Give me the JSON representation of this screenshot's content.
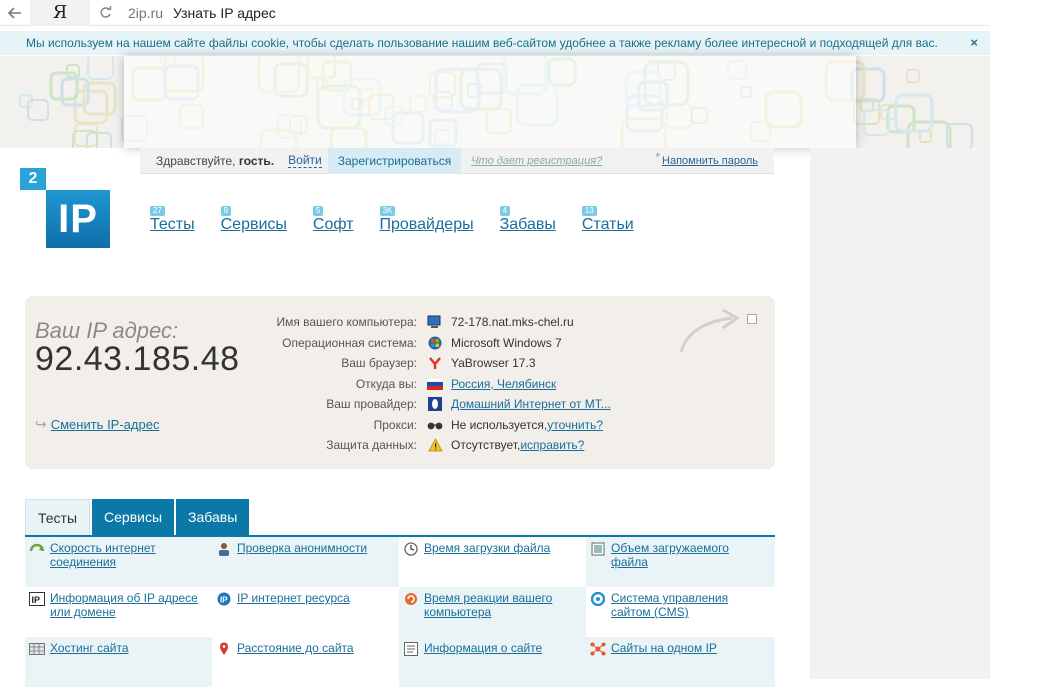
{
  "browser": {
    "back_icon": "arrow-left-icon",
    "yandex_glyph": "Я",
    "reload_icon": "reload-icon",
    "domain": "2ip.ru",
    "title": "Узнать IP адрес"
  },
  "cookie": {
    "text": "Мы используем на нашем сайте файлы cookie, чтобы сделать пользование нашим веб-сайтом удобнее а также рекламу более интересной и подходящей для вас.",
    "close": "×"
  },
  "login": {
    "hello": "Здравствуйте, ",
    "guest": "гость.",
    "login_link": "Войти",
    "register": "Зарегистрироваться",
    "what_gives": "Что дает регистрация?",
    "star": "*",
    "remind": "Напомнить пароль"
  },
  "logo": {
    "small": "2",
    "big": "IP"
  },
  "nav": [
    {
      "badge": "27",
      "label": "Тесты"
    },
    {
      "badge": "9",
      "label": "Сервисы"
    },
    {
      "badge": "5",
      "label": "Софт"
    },
    {
      "badge": "3K",
      "label": "Провайдеры"
    },
    {
      "badge": "4",
      "label": "Забавы"
    },
    {
      "badge": "13",
      "label": "Статьи"
    }
  ],
  "ipbox": {
    "title": "Ваш IP адрес:",
    "ip": "92.43.185.48",
    "change_link": "Сменить IP-адрес",
    "rows": [
      {
        "key": "Имя вашего компьютера:",
        "value": "72-178.nat.mks-chel.ru",
        "link": "",
        "icon": "computer-icon"
      },
      {
        "key": "Операционная система:",
        "value": "Microsoft Windows 7",
        "link": "",
        "icon": "windows-icon"
      },
      {
        "key": "Ваш браузер:",
        "value": "YaBrowser 17.3",
        "link": "",
        "icon": "yandex-browser-icon"
      },
      {
        "key": "Откуда вы:",
        "value": "",
        "link": "Россия, Челябинск",
        "icon": "russia-flag-icon"
      },
      {
        "key": "Ваш провайдер:",
        "value": "",
        "link": "Домашний Интернет от МТ...",
        "icon": "provider-icon"
      },
      {
        "key": "Прокси:",
        "value": "Не используется, ",
        "link": "уточнить?",
        "icon": "glasses-icon"
      },
      {
        "key": "Защита данных:",
        "value": "Отсутствует, ",
        "link": "исправить?",
        "icon": "warning-icon"
      }
    ]
  },
  "tabs": [
    "Тесты",
    "Сервисы",
    "Забавы"
  ],
  "tests": [
    [
      {
        "icon": "speed-icon",
        "text": "Скорость интернет соединения"
      },
      {
        "icon": "anonymity-icon",
        "text": "Проверка анонимности"
      },
      {
        "icon": "clock-icon",
        "text": "Время загрузки файла"
      },
      {
        "icon": "file-size-icon",
        "text": "Объем загружаемого файла"
      }
    ],
    [
      {
        "icon": "ip-info-icon",
        "text": "Информация об IP адресе или домене"
      },
      {
        "icon": "ip-resource-icon",
        "text": "IP интернет ресурса"
      },
      {
        "icon": "response-time-icon",
        "text": "Время реакции вашего компьютера"
      },
      {
        "icon": "cms-icon",
        "text": "Система управления сайтом (CMS)"
      }
    ],
    [
      {
        "icon": "hosting-icon",
        "text": "Хостинг сайта"
      },
      {
        "icon": "location-pin-icon",
        "text": "Расстояние до сайта"
      },
      {
        "icon": "site-info-icon",
        "text": "Информация о сайте"
      },
      {
        "icon": "same-ip-icon",
        "text": "Сайты на одном IP"
      }
    ]
  ]
}
